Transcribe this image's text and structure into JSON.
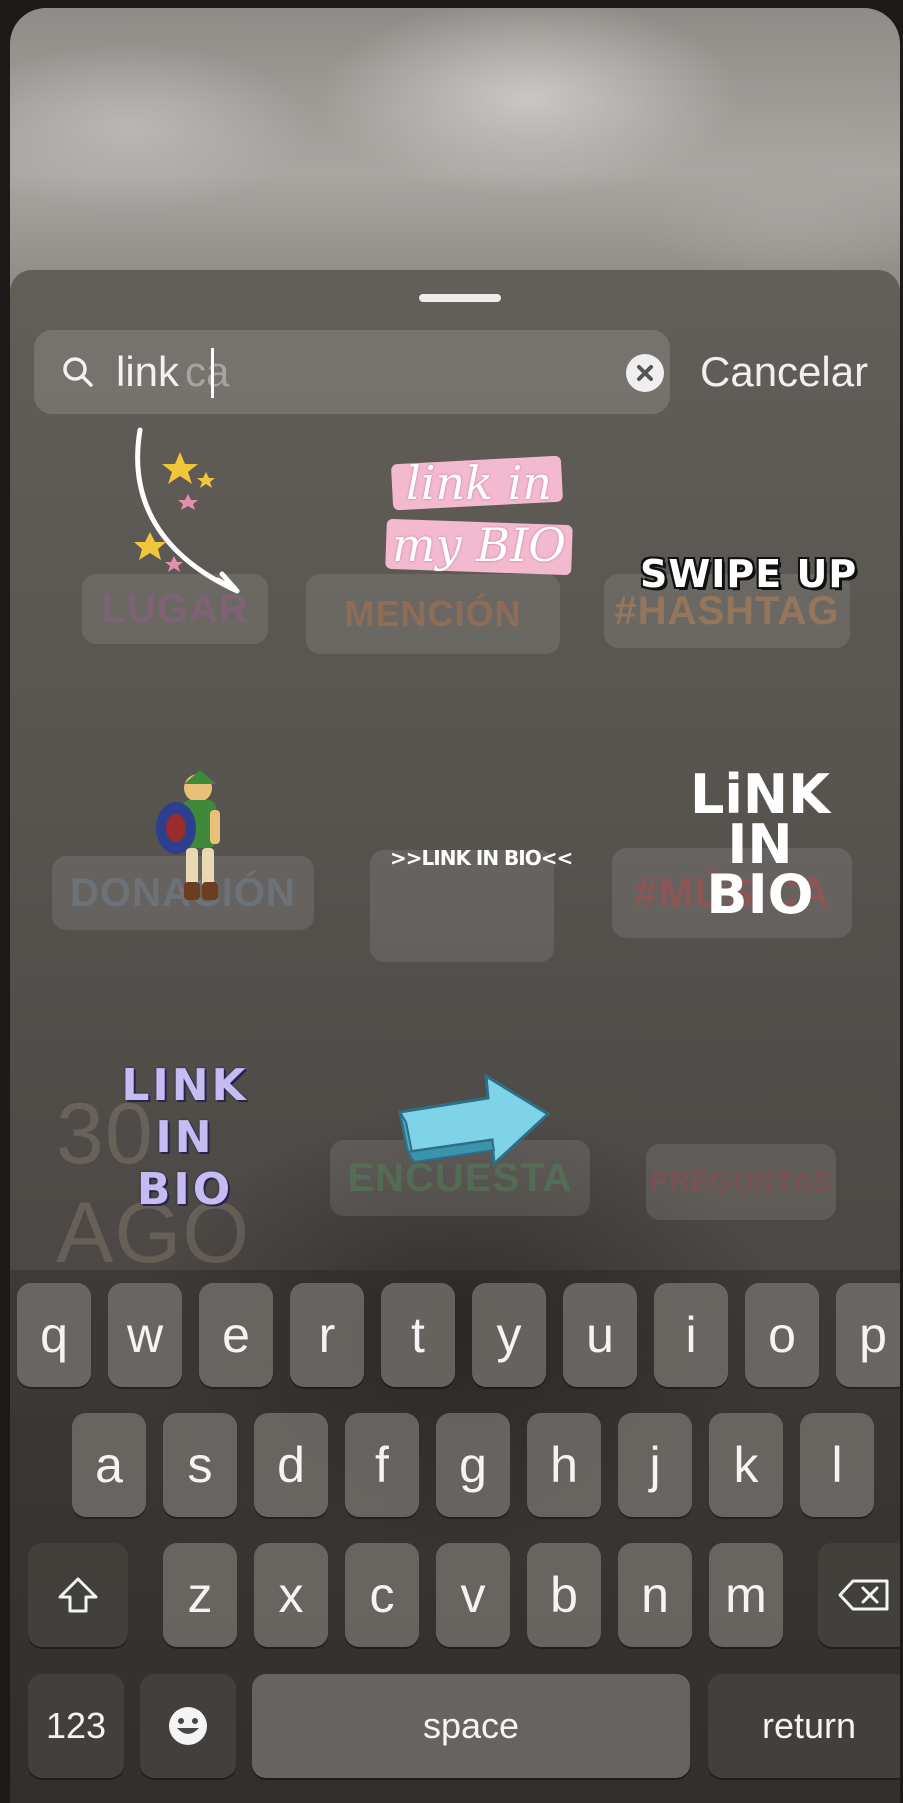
{
  "search": {
    "query": "link",
    "placeholder_remainder": "ca",
    "cancel_label": "Cancelar"
  },
  "ghost_stickers": {
    "row1": [
      "LUGAR",
      "MENCIÓN",
      "#HASHTAG"
    ],
    "row2": [
      "DONACIÓN",
      "",
      "#MÚSICA"
    ],
    "row3": [
      "30 AGO",
      "ENCUESTA",
      "PREGUNTAS"
    ]
  },
  "stickers": {
    "link_in_my_bio_line1": "link in",
    "link_in_my_bio_line2": "my BIO",
    "swipe_up": "SWIPE UP",
    "link_in_bio_small": ">>LINK IN BIO<<",
    "link_in_bio_hand": [
      "LiNK",
      "IN",
      "BIO"
    ],
    "link_in_bio_purple": [
      "LINK",
      "IN",
      "BIO"
    ]
  },
  "keyboard": {
    "row1": [
      "q",
      "w",
      "e",
      "r",
      "t",
      "y",
      "u",
      "i",
      "o",
      "p"
    ],
    "row2": [
      "a",
      "s",
      "d",
      "f",
      "g",
      "h",
      "j",
      "k",
      "l"
    ],
    "row3": [
      "z",
      "x",
      "c",
      "v",
      "b",
      "n",
      "m"
    ],
    "numbers_label": "123",
    "space_label": "space",
    "return_label": "return"
  }
}
